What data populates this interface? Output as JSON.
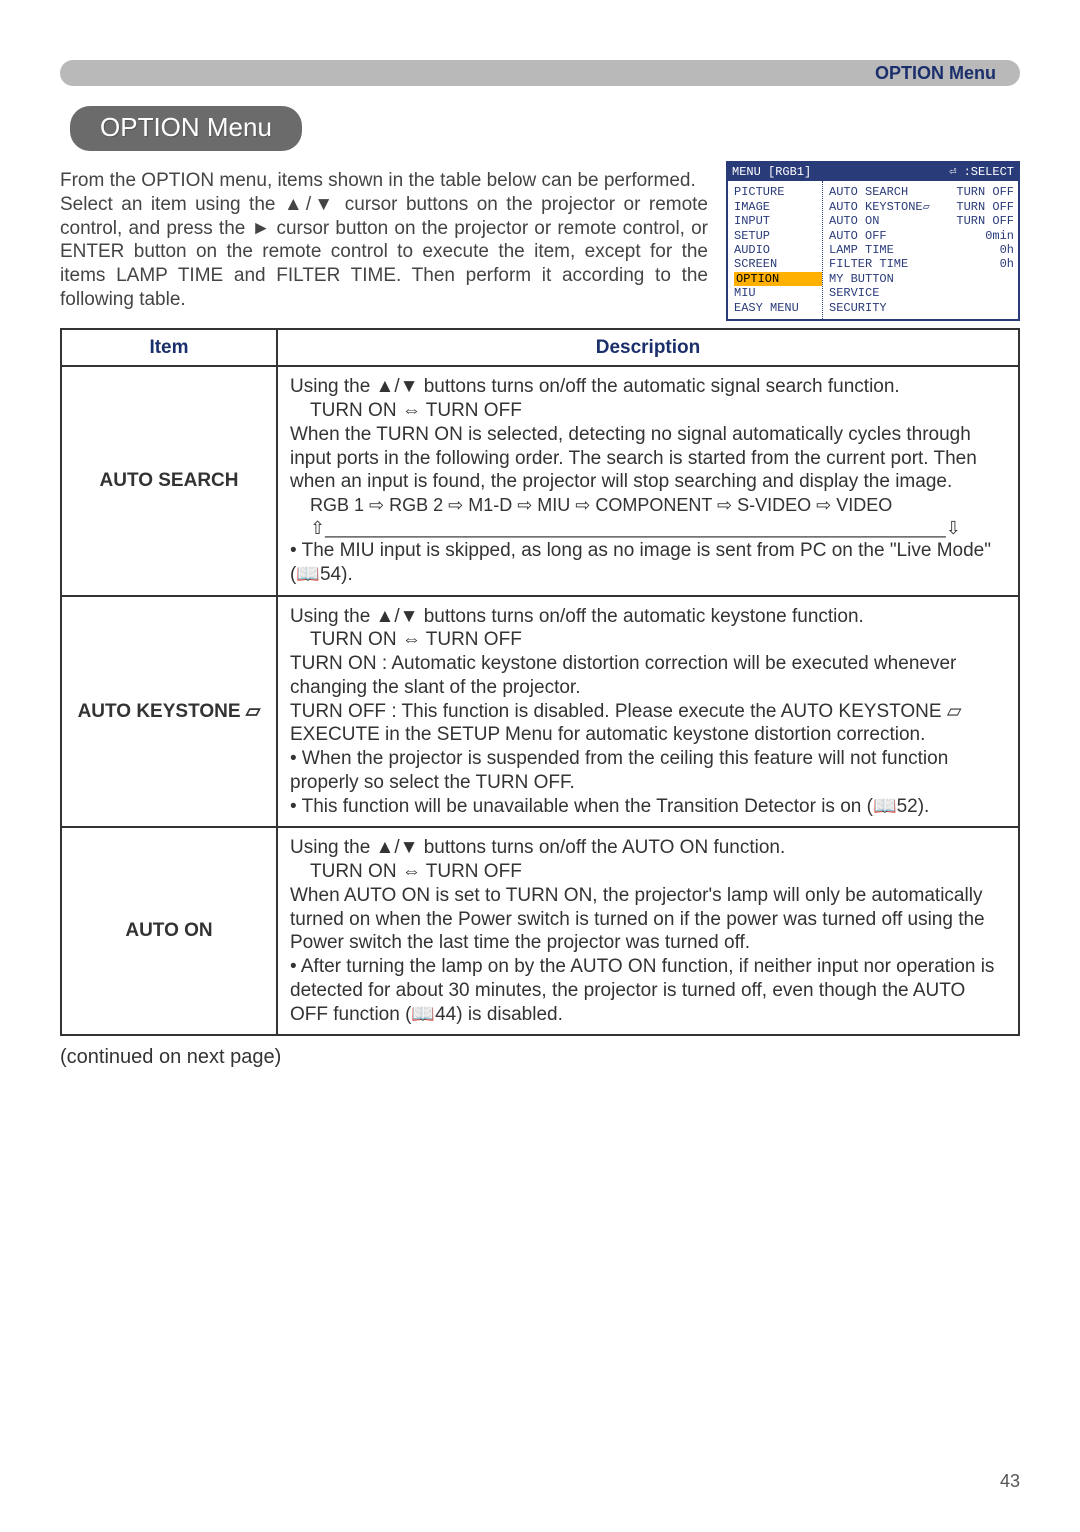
{
  "header": {
    "label": "OPTION Menu"
  },
  "section_title": "OPTION Menu",
  "intro": "From the OPTION menu, items shown in the table below can be performed.\nSelect an item using the ▲/▼ cursor buttons on the projector or remote control, and press the ► cursor button on the projector or remote control, or ENTER button on the remote control to execute the item, except for the items LAMP TIME and FILTER TIME. Then perform it according to the following table.",
  "osd": {
    "title_left": "MENU [RGB1]",
    "title_right": "⏎ :SELECT",
    "left_items": [
      "PICTURE",
      "IMAGE",
      "INPUT",
      "SETUP",
      "AUDIO",
      "SCREEN",
      "OPTION",
      "MIU",
      "EASY MENU"
    ],
    "highlight": "OPTION",
    "right_rows": [
      {
        "l": "AUTO SEARCH",
        "r": "TURN OFF"
      },
      {
        "l": "AUTO KEYSTONE▱",
        "r": "TURN OFF"
      },
      {
        "l": "AUTO ON",
        "r": "TURN OFF"
      },
      {
        "l": "AUTO OFF",
        "r": "0min"
      },
      {
        "l": "LAMP TIME",
        "r": "0h"
      },
      {
        "l": "FILTER TIME",
        "r": "0h"
      },
      {
        "l": "MY BUTTON",
        "r": ""
      },
      {
        "l": "SERVICE",
        "r": ""
      },
      {
        "l": "SECURITY",
        "r": ""
      }
    ]
  },
  "table": {
    "headers": {
      "item": "Item",
      "desc": "Description"
    },
    "rows": [
      {
        "item": "AUTO SEARCH",
        "desc_lines": [
          "Using the ▲/▼ buttons turns on/off the automatic signal search function.",
          "TURN ON ⇔ TURN OFF",
          "When the TURN ON is selected, detecting no signal automatically cycles through input ports in the following order. The search is started from the current port. Then when an input is found, the projector will stop searching and display the image.",
          "RGB 1 ⇨ RGB 2 ⇨ M1-D ⇨ MIU ⇨ COMPONENT ⇨ S-VIDEO ⇨ VIDEO",
          "⇧______________________________________________________________⇩",
          "• The MIU input is skipped, as long as no image is sent from PC on the \"Live Mode\" (📖54)."
        ]
      },
      {
        "item": "AUTO KEYSTONE ▱",
        "desc_lines": [
          "Using the ▲/▼ buttons turns on/off the automatic keystone function.",
          "TURN ON ⇔ TURN OFF",
          "TURN ON : Automatic keystone distortion correction will be executed whenever changing the slant of the projector.",
          "TURN OFF : This function is disabled. Please execute the AUTO KEYSTONE ▱ EXECUTE in the SETUP Menu for automatic keystone distortion correction.",
          "• When the projector is suspended from the ceiling this feature will not function properly so select the TURN OFF.",
          "• This function will be unavailable when the Transition Detector is on (📖52)."
        ]
      },
      {
        "item": "AUTO ON",
        "desc_lines": [
          "Using the ▲/▼ buttons turns on/off the AUTO ON function.",
          "TURN ON ⇔ TURN OFF",
          "When AUTO ON is set to TURN ON, the projector's lamp will only be automatically turned on when the Power switch is turned on if the power was turned off using the Power switch the last time the projector was turned off.",
          "• After turning the lamp on by the AUTO ON function, if neither input nor operation is detected for about 30 minutes, the projector is turned off, even though the AUTO OFF function (📖44) is disabled."
        ]
      }
    ]
  },
  "continued": "(continued on next page)",
  "page_number": "43"
}
